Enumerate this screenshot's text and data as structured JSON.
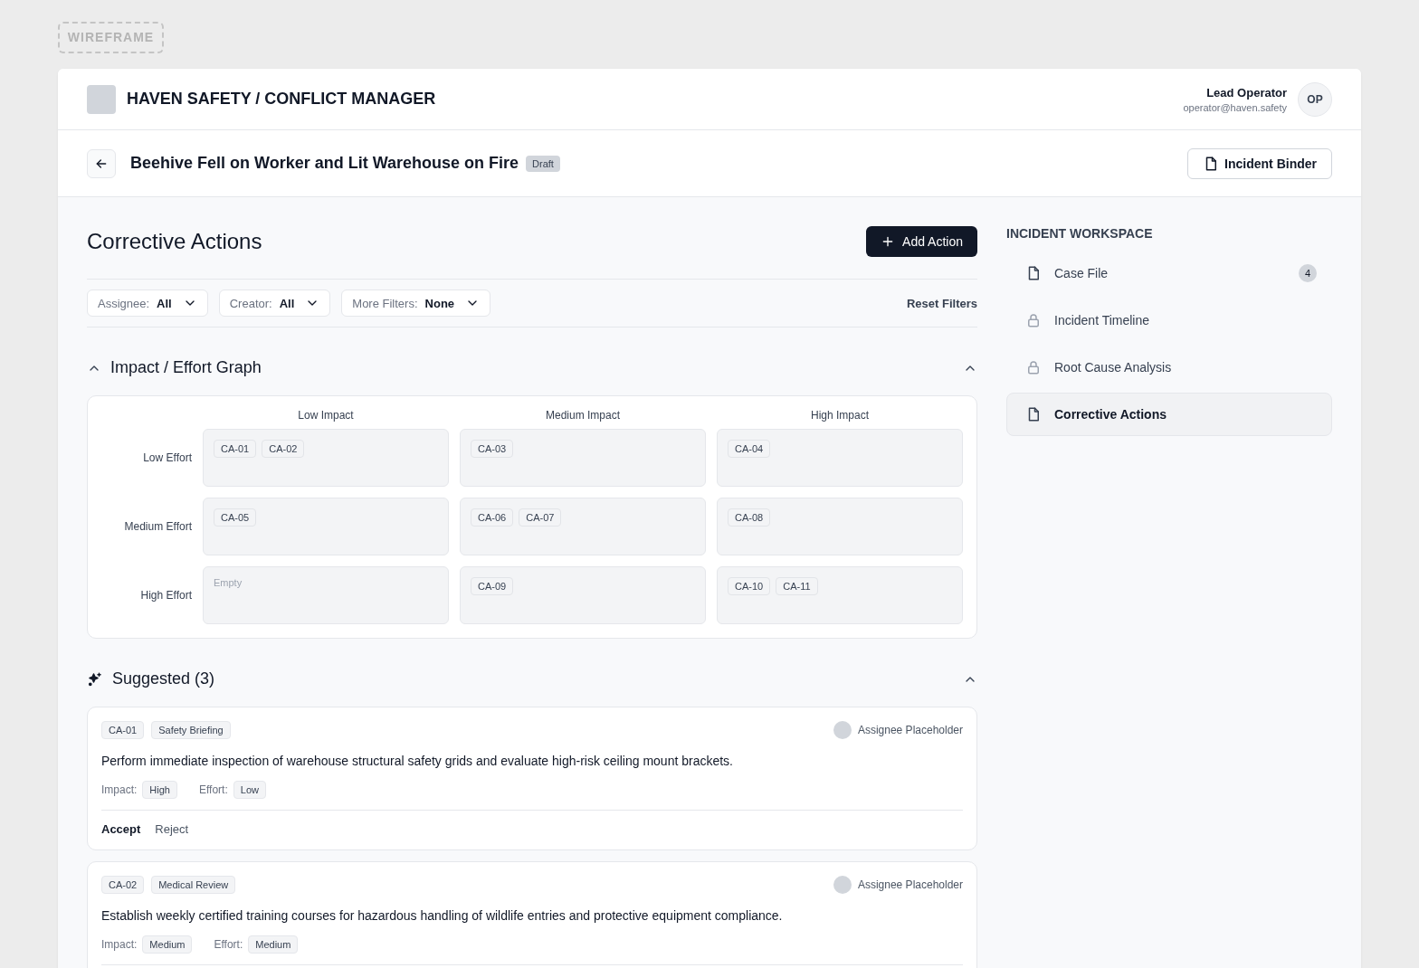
{
  "frame_label": "WIREFRAME",
  "header": {
    "app_title": "HAVEN SAFETY / CONFLICT MANAGER",
    "user": {
      "name": "Lead Operator",
      "email": "operator@haven.safety",
      "initials": "OP"
    }
  },
  "incident": {
    "title": "Beehive Fell on Worker and Lit Warehouse on Fire",
    "status": "Draft",
    "binder_button": "Incident Binder"
  },
  "page": {
    "title": "Corrective Actions",
    "add_button": "Add Action"
  },
  "filters": [
    {
      "label": "Assignee:",
      "value": "All"
    },
    {
      "label": "Creator:",
      "value": "All"
    },
    {
      "label": "More Filters:",
      "value": "None"
    }
  ],
  "reset_filters": "Reset Filters",
  "graph": {
    "title": "Impact / Effort Graph",
    "expanded": true,
    "columns": [
      "Low Impact",
      "Medium Impact",
      "High Impact"
    ],
    "rows": [
      {
        "label": "Low Effort",
        "cells": [
          {
            "items": [
              "CA-01",
              "CA-02"
            ]
          },
          {
            "items": [
              "CA-03"
            ]
          },
          {
            "items": [
              "CA-04"
            ]
          }
        ]
      },
      {
        "label": "Medium Effort",
        "cells": [
          {
            "items": [
              "CA-05"
            ]
          },
          {
            "items": [
              "CA-06",
              "CA-07"
            ]
          },
          {
            "items": [
              "CA-08"
            ]
          }
        ]
      },
      {
        "label": "High Effort",
        "cells": [
          {
            "note": "Empty"
          },
          {
            "items": [
              "CA-09"
            ]
          },
          {
            "items": [
              "CA-10",
              "CA-11"
            ]
          }
        ]
      }
    ]
  },
  "suggested": {
    "title": "Suggested (3)",
    "expanded": true,
    "items": [
      {
        "id": "CA-01",
        "category": "Safety Briefing",
        "assignee": "Assignee Placeholder",
        "text": "Perform immediate inspection of warehouse structural safety grids and evaluate high-risk ceiling mount brackets.",
        "impact_label": "Impact:",
        "impact": "High",
        "effort_label": "Effort:",
        "effort": "Low",
        "actions": [
          "Accept",
          "Reject"
        ]
      },
      {
        "id": "CA-02",
        "category": "Medical Review",
        "assignee": "Assignee Placeholder",
        "text": "Establish weekly certified training courses for hazardous handling of wildlife entries and protective equipment compliance.",
        "impact_label": "Impact:",
        "impact": "Medium",
        "effort_label": "Effort:",
        "effort": "Medium"
      }
    ]
  },
  "sidebar": {
    "title": "INCIDENT WORKSPACE",
    "items": [
      {
        "label": "Case File",
        "kind": "document",
        "badge": "4",
        "selected": false
      },
      {
        "label": "Incident Timeline",
        "kind": "locked",
        "selected": false
      },
      {
        "label": "Root Cause Analysis",
        "kind": "locked",
        "selected": false
      },
      {
        "label": "Corrective Actions",
        "kind": "document",
        "selected": true
      }
    ]
  }
}
